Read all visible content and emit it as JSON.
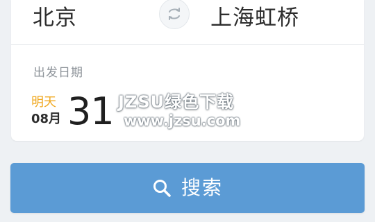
{
  "route": {
    "from_city": "北京",
    "to_city": "上海虹桥",
    "swap_icon": "swap-icon"
  },
  "date": {
    "label": "出发日期",
    "relative_day": "明天",
    "month": "08月",
    "day": "31"
  },
  "watermark": {
    "title": "JZSU绿色下载",
    "url": "www.jzsu.com"
  },
  "search": {
    "label": "搜索",
    "icon": "search-icon"
  },
  "colors": {
    "accent": "#5b9bd5",
    "relative_day": "#f0a81f"
  }
}
